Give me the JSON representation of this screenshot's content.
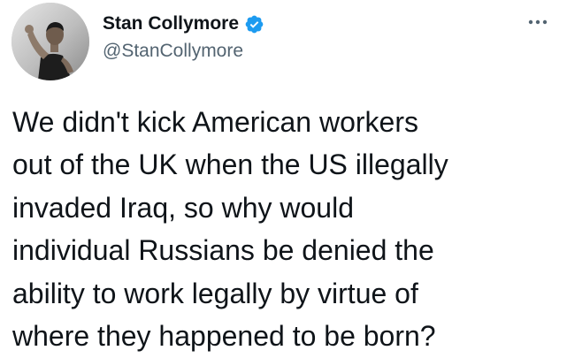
{
  "tweet": {
    "author": {
      "display_name": "Stan Collymore",
      "handle": "@StanCollymore",
      "verified": true,
      "verified_icon": "verified-badge-icon",
      "avatar_icon": "profile-photo"
    },
    "more_icon": "more-dots-icon",
    "text_lines": [
      "We didn't kick American workers",
      "out of the UK when the US illegally",
      "invaded Iraq, so why would",
      "individual Russians be denied the",
      "ability to work legally by virtue of",
      "where they happened to be born?"
    ]
  },
  "colors": {
    "text": "#0f1419",
    "secondary": "#536471",
    "verified": "#1d9bf0"
  }
}
